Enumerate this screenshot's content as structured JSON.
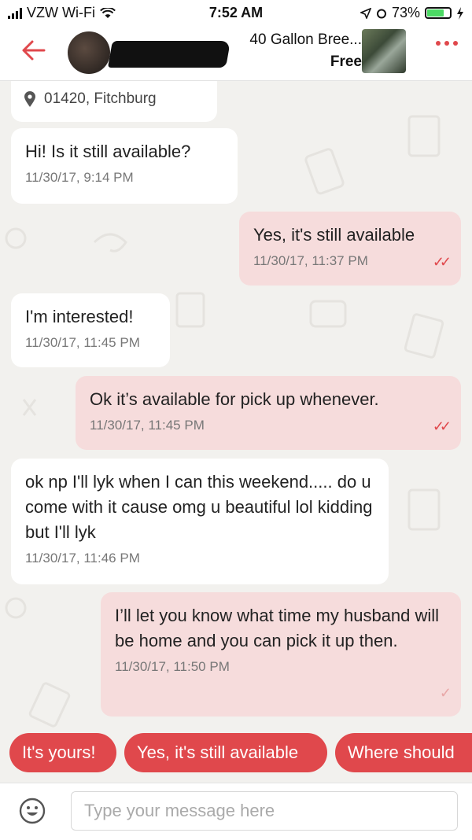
{
  "status": {
    "carrier": "VZW Wi-Fi",
    "time": "7:52 AM",
    "battery": "73%"
  },
  "header": {
    "listing_title": "40 Gallon Bree...",
    "listing_price": "Free"
  },
  "location": {
    "text": "01420, Fitchburg"
  },
  "messages": [
    {
      "direction": "in",
      "text": "Hi! Is it still available?",
      "time": "11/30/17, 9:14 PM"
    },
    {
      "direction": "out",
      "text": "Yes, it's still available",
      "time": "11/30/17, 11:37 PM",
      "status": "read"
    },
    {
      "direction": "in",
      "text": "I'm interested!",
      "time": "11/30/17, 11:45 PM"
    },
    {
      "direction": "out",
      "text": "Ok it’s available for pick up whenever.",
      "time": "11/30/17, 11:45 PM",
      "status": "read"
    },
    {
      "direction": "in",
      "text": "ok np I'll lyk when I can this weekend..... do u come with it cause omg u beautiful lol kidding but I'll lyk",
      "time": "11/30/17, 11:46 PM"
    },
    {
      "direction": "out",
      "text": "I’ll let you know what time my husband will be home and you can pick it up then.",
      "time": "11/30/17, 11:50 PM",
      "status": "sent"
    }
  ],
  "quick_replies": [
    "It's yours!",
    "Yes, it's still available",
    "Where should"
  ],
  "composer": {
    "placeholder": "Type your message here"
  },
  "colors": {
    "accent": "#e0484c",
    "outgoing_bubble": "#f6dcdc",
    "incoming_bubble": "#ffffff",
    "background": "#f2f1ee"
  }
}
